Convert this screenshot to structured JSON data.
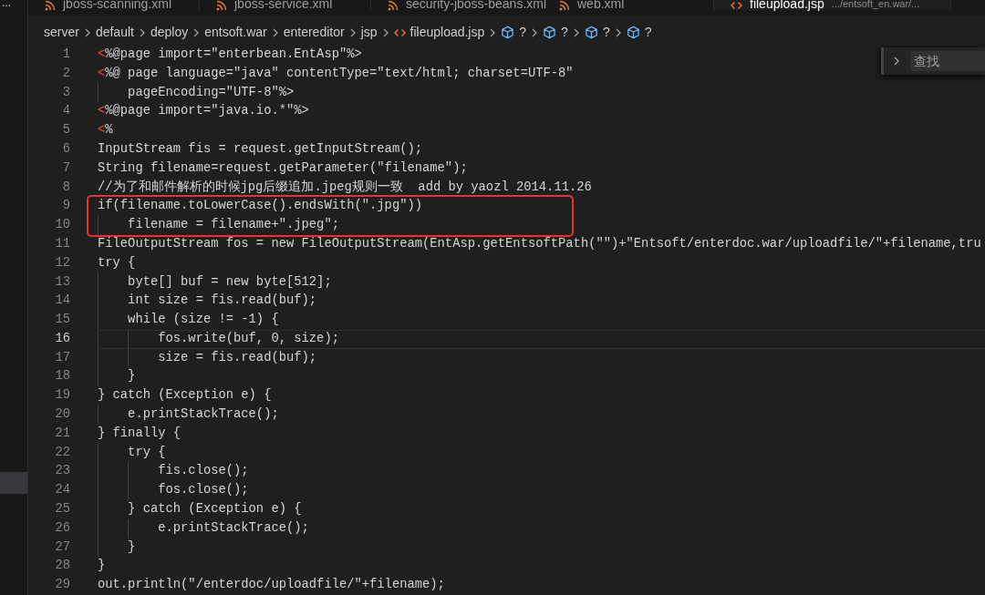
{
  "activity_bar": {
    "more": "..."
  },
  "tabs": [
    {
      "label": "jboss-scanning.xml",
      "kind": "xml",
      "selected": false
    },
    {
      "label": "jboss-service.xml",
      "kind": "xml",
      "selected": false
    },
    {
      "label": "security-jboss-beans.xml",
      "kind": "xml",
      "selected": false
    },
    {
      "label": "web.xml",
      "kind": "xml",
      "selected": false
    },
    {
      "label": "fileupload.jsp",
      "kind": "jsp",
      "description": ".../entsoft_en.war/...",
      "selected": true
    }
  ],
  "breadcrumb": [
    {
      "label": "server",
      "kind": "folder"
    },
    {
      "label": "default",
      "kind": "folder"
    },
    {
      "label": "deploy",
      "kind": "folder"
    },
    {
      "label": "entsoft.war",
      "kind": "folder"
    },
    {
      "label": "entereditor",
      "kind": "folder"
    },
    {
      "label": "jsp",
      "kind": "folder"
    },
    {
      "label": "fileupload.jsp",
      "kind": "file"
    },
    {
      "label": "?",
      "kind": "symbol"
    },
    {
      "label": "?",
      "kind": "symbol"
    },
    {
      "label": "?",
      "kind": "symbol"
    },
    {
      "label": "?",
      "kind": "symbol"
    }
  ],
  "find_widget": {
    "placeholder": "查找"
  },
  "lines": [
    {
      "number": "1",
      "tag": "<",
      "code": "%@page import=\"enterbean.EntAsp\"%>",
      "current": false,
      "highlighted": false
    },
    {
      "number": "2",
      "tag": "<",
      "code": "%@ page language=\"java\" contentType=\"text/html; charset=UTF-8\"",
      "current": false,
      "highlighted": false
    },
    {
      "number": "3",
      "code": "    pageEncoding=\"UTF-8\"%>",
      "current": false,
      "highlighted": false
    },
    {
      "number": "4",
      "tag": "<",
      "code": "%@page import=\"java.io.*\"%>",
      "current": false,
      "highlighted": false
    },
    {
      "number": "5",
      "tag": "<",
      "code": "%",
      "current": false,
      "highlighted": false
    },
    {
      "number": "6",
      "code": "InputStream fis = request.getInputStream();",
      "current": false,
      "highlighted": false
    },
    {
      "number": "7",
      "code": "String filename=request.getParameter(\"filename\");",
      "current": false,
      "highlighted": false
    },
    {
      "number": "8",
      "code": "//为了和邮件解析的时候jpg后缀追加.jpeg规则一致  add by yaozl 2014.11.26",
      "current": false,
      "highlighted": false
    },
    {
      "number": "9",
      "code": "if(filename.toLowerCase().endsWith(\".jpg\"))",
      "current": false,
      "highlighted": true
    },
    {
      "number": "10",
      "code": "    filename = filename+\".jpeg\";",
      "current": false,
      "highlighted": true
    },
    {
      "number": "11",
      "code": "FileOutputStream fos = new FileOutputStream(EntAsp.getEntsoftPath(\"\")+\"Entsoft/enterdoc.war/uploadfile/\"+filename,tru",
      "current": false,
      "highlighted": false
    },
    {
      "number": "12",
      "code": "try {",
      "current": false,
      "highlighted": false
    },
    {
      "number": "13",
      "code": "    byte[] buf = new byte[512];",
      "current": false,
      "highlighted": false
    },
    {
      "number": "14",
      "code": "    int size = fis.read(buf);",
      "current": false,
      "highlighted": false
    },
    {
      "number": "15",
      "code": "    while (size != -1) {",
      "current": false,
      "highlighted": false
    },
    {
      "number": "16",
      "code": "        fos.write(buf, 0, size);",
      "current": true,
      "highlighted": false
    },
    {
      "number": "17",
      "code": "        size = fis.read(buf);",
      "current": false,
      "highlighted": false
    },
    {
      "number": "18",
      "code": "    }",
      "current": false,
      "highlighted": false
    },
    {
      "number": "19",
      "code": "} catch (Exception e) {",
      "current": false,
      "highlighted": false
    },
    {
      "number": "20",
      "code": "    e.printStackTrace();",
      "current": false,
      "highlighted": false
    },
    {
      "number": "21",
      "code": "} finally {",
      "current": false,
      "highlighted": false
    },
    {
      "number": "22",
      "code": "    try {",
      "current": false,
      "highlighted": false
    },
    {
      "number": "23",
      "code": "        fis.close();",
      "current": false,
      "highlighted": false
    },
    {
      "number": "24",
      "code": "        fos.close();",
      "current": false,
      "highlighted": false
    },
    {
      "number": "25",
      "code": "    } catch (Exception e) {",
      "current": false,
      "highlighted": false
    },
    {
      "number": "26",
      "code": "        e.printStackTrace();",
      "current": false,
      "highlighted": false
    },
    {
      "number": "27",
      "code": "    }",
      "current": false,
      "highlighted": false
    },
    {
      "number": "28",
      "code": "}",
      "current": false,
      "highlighted": false
    },
    {
      "number": "29",
      "code": "out.println(\"/enterdoc/uploadfile/\"+filename);",
      "current": false,
      "highlighted": false
    }
  ]
}
